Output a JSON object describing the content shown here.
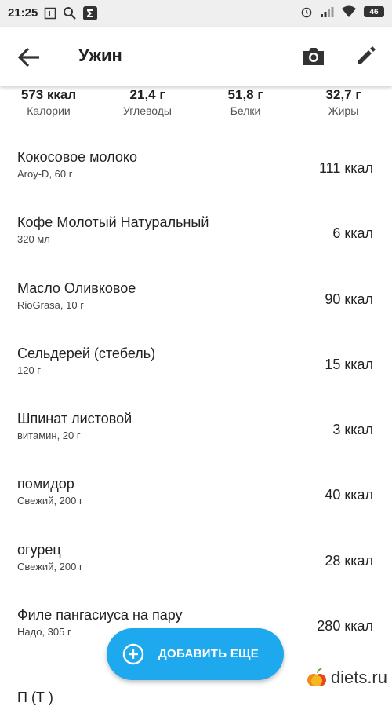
{
  "status_bar": {
    "time": "21:25",
    "battery": "46"
  },
  "header": {
    "title": "Ужин"
  },
  "summary": [
    {
      "value": "573 ккал",
      "label": "Калории"
    },
    {
      "value": "21,4 г",
      "label": "Углеводы"
    },
    {
      "value": "51,8 г",
      "label": "Белки"
    },
    {
      "value": "32,7 г",
      "label": "Жиры"
    }
  ],
  "foods": [
    {
      "name": "Кокосовое молоко",
      "detail": "Aroy-D, 60 г",
      "kcal": "111 ккал"
    },
    {
      "name": "Кофе Молотый Натуральный",
      "detail": "320 мл",
      "kcal": "6 ккал"
    },
    {
      "name": "Масло Оливковое",
      "detail": "RioGrasa, 10 г",
      "kcal": "90 ккал"
    },
    {
      "name": "Сельдерей (стебель)",
      "detail": "120 г",
      "kcal": "15 ккал"
    },
    {
      "name": "Шпинат листовой",
      "detail": "витамин, 20 г",
      "kcal": "3 ккал"
    },
    {
      "name": "помидор",
      "detail": "Свежий, 200 г",
      "kcal": "40 ккал"
    },
    {
      "name": "огурец",
      "detail": "Свежий, 200 г",
      "kcal": "28 ккал"
    },
    {
      "name": "Филе пангасиуса на пару",
      "detail": "Надо, 305 г",
      "kcal": "280 ккал"
    }
  ],
  "partial_row_text": "П                                          (Т     )",
  "fab": {
    "label": "ДОБАВИТЬ ЕЩЕ"
  },
  "watermark": {
    "text": "diets.ru"
  },
  "colors": {
    "accent": "#1ea8ee",
    "status_bar_bg": "#efefef"
  }
}
